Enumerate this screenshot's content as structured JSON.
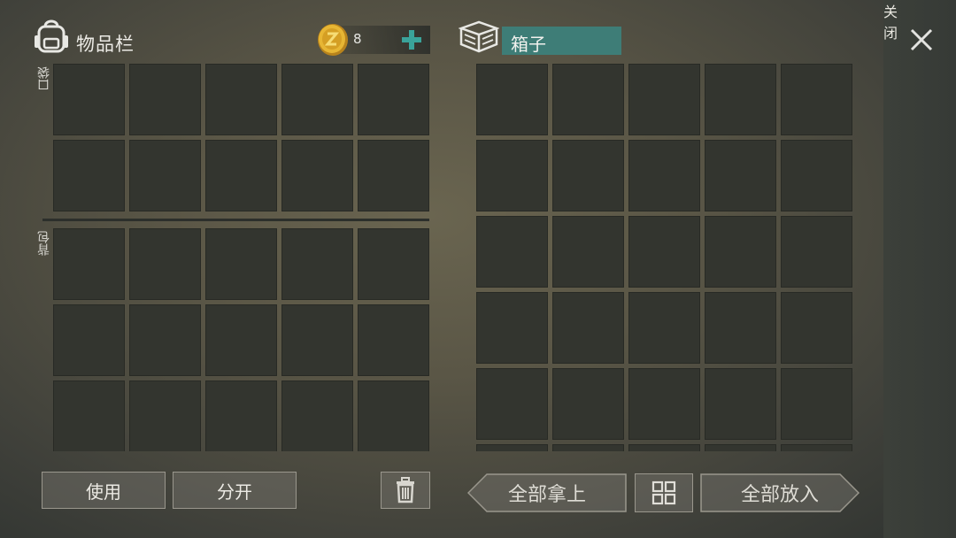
{
  "inventory": {
    "title": "物品栏",
    "pocket_label": "口袋",
    "backpack_label": "背包",
    "coin_count": "8"
  },
  "container": {
    "name": "箱子"
  },
  "close_label": "关闭",
  "actions": {
    "use": "使用",
    "split": "分开",
    "take_all": "全部拿上",
    "put_all": "全部放入"
  },
  "icons": {
    "backpack": "backpack-icon",
    "coin": "coin-icon",
    "plus": "plus-icon",
    "box": "box-icon",
    "close": "close-icon",
    "trash": "trash-icon",
    "sort": "sort-grid-icon"
  },
  "colors": {
    "accent": "#3aa39a",
    "name_bar": "#3e7d77",
    "slot": "#33352f",
    "coin": "#d9a62a"
  }
}
